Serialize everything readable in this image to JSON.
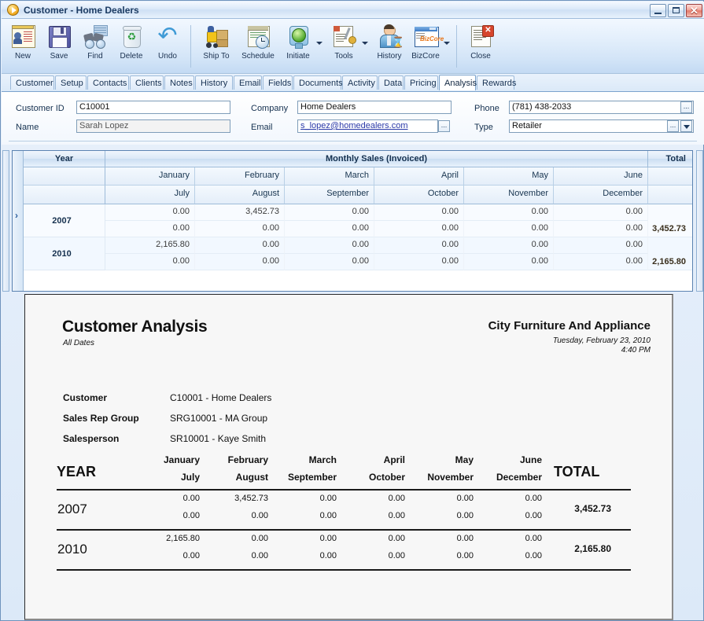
{
  "window": {
    "title": "Customer - Home Dealers",
    "icon": "play-circle-icon",
    "controls": {
      "minimize": "Minimize",
      "maximize": "Maximize",
      "close": "Close"
    }
  },
  "toolbar": {
    "items": [
      {
        "label": "New",
        "icon": "new-record-icon",
        "dropdown": false
      },
      {
        "label": "Save",
        "icon": "floppy-disk-icon",
        "dropdown": false
      },
      {
        "label": "Find",
        "icon": "binoculars-icon",
        "dropdown": false
      },
      {
        "label": "Delete",
        "icon": "recycle-bin-icon",
        "dropdown": false
      },
      {
        "label": "Undo",
        "icon": "undo-arrow-icon",
        "dropdown": false
      },
      {
        "label": "Ship To",
        "icon": "forklift-icon",
        "dropdown": false
      },
      {
        "label": "Schedule",
        "icon": "calendar-clock-icon",
        "dropdown": false
      },
      {
        "label": "Initiate",
        "icon": "traffic-light-icon",
        "dropdown": true
      },
      {
        "label": "Tools",
        "icon": "wrench-document-icon",
        "dropdown": true
      },
      {
        "label": "History",
        "icon": "person-hourglass-icon",
        "dropdown": false
      },
      {
        "label": "BizCore",
        "icon": "bizcore-window-icon",
        "dropdown": true
      },
      {
        "label": "Close",
        "icon": "close-document-icon",
        "dropdown": false
      }
    ]
  },
  "tabs": {
    "selected": "Analysis",
    "items": [
      "Customer",
      "Setup",
      "Contacts",
      "Clients",
      "Notes",
      "History",
      "Email",
      "Fields",
      "Documents",
      "Activity",
      "Data",
      "Pricing",
      "Analysis",
      "Rewards"
    ]
  },
  "form": {
    "customer_id": {
      "label": "Customer ID",
      "value": "C10001"
    },
    "name": {
      "label": "Name",
      "value": "Sarah Lopez"
    },
    "company": {
      "label": "Company",
      "value": "Home Dealers"
    },
    "email": {
      "label": "Email",
      "value": "s_lopez@homedealers.com"
    },
    "phone": {
      "label": "Phone",
      "value": "(781) 438-2033"
    },
    "type": {
      "label": "Type",
      "value": "Retailer"
    },
    "ellipsis_label": "..."
  },
  "grid": {
    "headers": {
      "year": "Year",
      "monthly": "Monthly Sales (Invoiced)",
      "total": "Total"
    },
    "month_row_1": [
      "January",
      "February",
      "March",
      "April",
      "May",
      "June"
    ],
    "month_row_2": [
      "July",
      "August",
      "September",
      "October",
      "November",
      "December"
    ],
    "rows": [
      {
        "year": "2007",
        "first_half": [
          "0.00",
          "3,452.73",
          "0.00",
          "0.00",
          "0.00",
          "0.00"
        ],
        "second_half": [
          "0.00",
          "0.00",
          "0.00",
          "0.00",
          "0.00",
          "0.00"
        ],
        "total": "3,452.73",
        "selected": true
      },
      {
        "year": "2010",
        "first_half": [
          "2,165.80",
          "0.00",
          "0.00",
          "0.00",
          "0.00",
          "0.00"
        ],
        "second_half": [
          "0.00",
          "0.00",
          "0.00",
          "0.00",
          "0.00",
          "0.00"
        ],
        "total": "2,165.80",
        "selected": false
      }
    ],
    "row_marker": "›"
  },
  "report": {
    "title": "Customer Analysis",
    "subtitle": "All Dates",
    "company": "City Furniture And Appliance",
    "date": "Tuesday, February 23, 2010",
    "time": "4:40 PM",
    "fields": [
      {
        "label": "Customer",
        "value": "C10001 - Home Dealers"
      },
      {
        "label": "Sales Rep Group",
        "value": "SRG10001 - MA Group"
      },
      {
        "label": "Salesperson",
        "value": "SR10001 - Kaye Smith"
      }
    ],
    "table": {
      "year_header": "YEAR",
      "total_header": "TOTAL",
      "month_row_1": [
        "January",
        "February",
        "March",
        "April",
        "May",
        "June"
      ],
      "month_row_2": [
        "July",
        "August",
        "September",
        "October",
        "November",
        "December"
      ],
      "rows": [
        {
          "year": "2007",
          "first_half": [
            "0.00",
            "3,452.73",
            "0.00",
            "0.00",
            "0.00",
            "0.00"
          ],
          "second_half": [
            "0.00",
            "0.00",
            "0.00",
            "0.00",
            "0.00",
            "0.00"
          ],
          "total": "3,452.73"
        },
        {
          "year": "2010",
          "first_half": [
            "2,165.80",
            "0.00",
            "0.00",
            "0.00",
            "0.00",
            "0.00"
          ],
          "second_half": [
            "0.00",
            "0.00",
            "0.00",
            "0.00",
            "0.00",
            "0.00"
          ],
          "total": "2,165.80"
        }
      ]
    }
  },
  "colors": {
    "accent": "#2d5f9e",
    "title_text": "#1d3c63",
    "close_red": "#e2796a",
    "link": "#2a39a8"
  }
}
